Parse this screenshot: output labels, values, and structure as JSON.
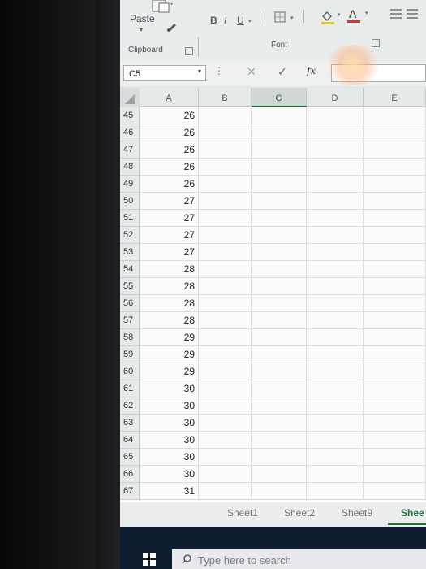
{
  "ribbon": {
    "paste_label": "Paste",
    "clipboard_label": "Clipboard",
    "font_label": "Font",
    "bold_label": "B",
    "italic_label": "I",
    "underline_label": "U",
    "icons": [
      "paste-icon",
      "format-painter-icon",
      "borders-icon",
      "fill-color-icon",
      "font-color-icon",
      "align-icon"
    ]
  },
  "formula_bar": {
    "name_box": "C5",
    "fx_label": "fx"
  },
  "columns": [
    "A",
    "B",
    "C",
    "D",
    "E"
  ],
  "selected_column": "C",
  "rows": [
    {
      "num": "45",
      "a": "26"
    },
    {
      "num": "46",
      "a": "26"
    },
    {
      "num": "47",
      "a": "26"
    },
    {
      "num": "48",
      "a": "26"
    },
    {
      "num": "49",
      "a": "26"
    },
    {
      "num": "50",
      "a": "27"
    },
    {
      "num": "51",
      "a": "27"
    },
    {
      "num": "52",
      "a": "27"
    },
    {
      "num": "53",
      "a": "27"
    },
    {
      "num": "54",
      "a": "28"
    },
    {
      "num": "55",
      "a": "28"
    },
    {
      "num": "56",
      "a": "28"
    },
    {
      "num": "57",
      "a": "28"
    },
    {
      "num": "58",
      "a": "29"
    },
    {
      "num": "59",
      "a": "29"
    },
    {
      "num": "60",
      "a": "29"
    },
    {
      "num": "61",
      "a": "30"
    },
    {
      "num": "62",
      "a": "30"
    },
    {
      "num": "63",
      "a": "30"
    },
    {
      "num": "64",
      "a": "30"
    },
    {
      "num": "65",
      "a": "30"
    },
    {
      "num": "66",
      "a": "30"
    },
    {
      "num": "67",
      "a": "31"
    }
  ],
  "sheet_tabs": [
    "Sheet1",
    "Sheet2",
    "Sheet9",
    "Shee"
  ],
  "active_tab": "Shee",
  "taskbar": {
    "search_placeholder": "Type here to search"
  },
  "colors": {
    "accent": "#217346",
    "taskbar": "#101c30"
  }
}
